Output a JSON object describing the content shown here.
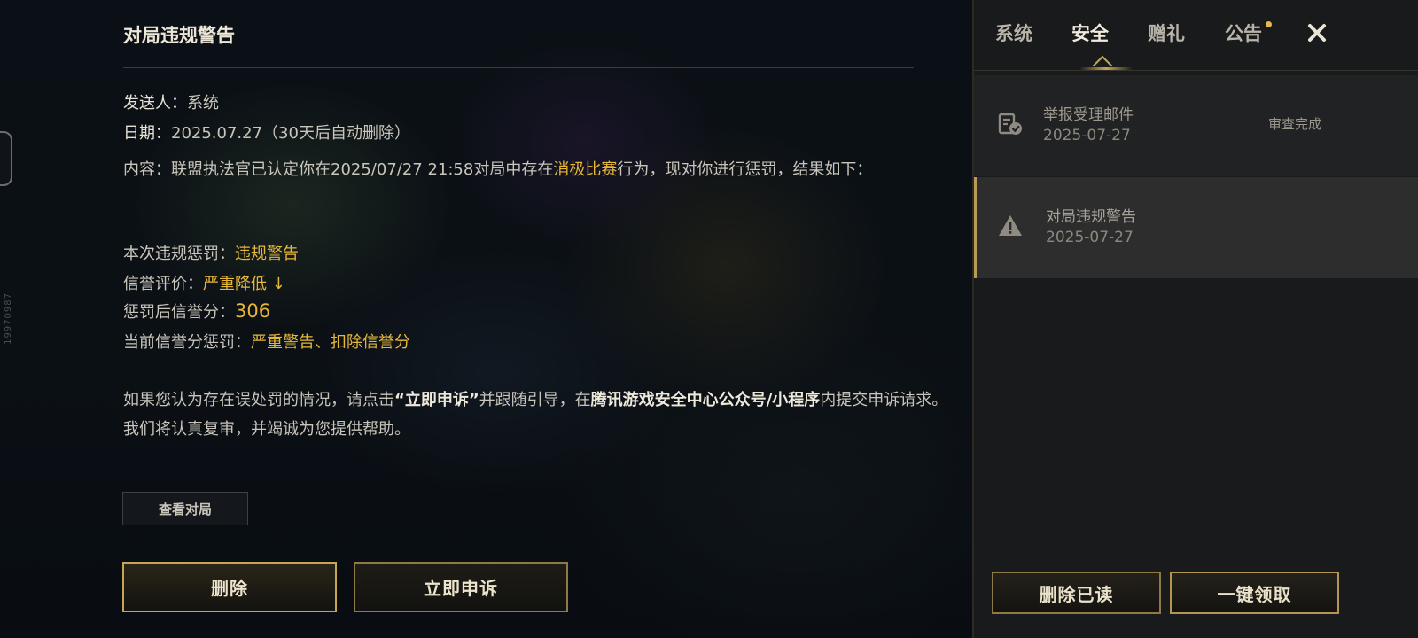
{
  "side_id": "19970987",
  "mail": {
    "title": "对局违规警告",
    "sender_label": "发送人：",
    "sender_value": "系统",
    "date_label": "日期：",
    "date_value": "2025.07.27（30天后自动删除）",
    "content_label": "内容：",
    "content_pre": "联盟执法官已认定你在2025/07/27 21:58对局中存在",
    "content_highlight": "消极比赛",
    "content_post": "行为，现对你进行惩罚，结果如下：",
    "penalties": [
      {
        "label": "本次违规惩罚：",
        "value": "违规警告"
      },
      {
        "label": "信誉评价：",
        "value": "严重降低 ↓"
      },
      {
        "label": "惩罚后信誉分：",
        "value": "306"
      },
      {
        "label": "当前信誉分惩罚：",
        "value": "严重警告、扣除信誉分"
      }
    ],
    "appeal_pre": "如果您认为存在误处罚的情况，请点击",
    "appeal_bold1": "“立即申诉”",
    "appeal_mid": "并跟随引导，在",
    "appeal_bold2": "腾讯游戏安全中心公众号/小程序",
    "appeal_post": "内提交申诉请求。我们将认真复审，并竭诚为您提供帮助。",
    "view_match_label": "查看对局",
    "delete_label": "删除",
    "appeal_button_label": "立即申诉"
  },
  "panel": {
    "tabs": [
      "系统",
      "安全",
      "赠礼",
      "公告"
    ],
    "active_tab": "安全",
    "items": [
      {
        "name": "举报受理邮件",
        "date": "2025-07-27",
        "status": "审查完成",
        "icon": "report-mail-check-icon"
      },
      {
        "name": "对局违规警告",
        "date": "2025-07-27",
        "status": "",
        "icon": "warning-triangle-icon"
      }
    ],
    "delete_read_label": "删除已读",
    "claim_all_label": "一键领取"
  },
  "colors": {
    "highlight": "#e7b73a",
    "gold_border": "#c7a553",
    "panel_bg": "#181a1c"
  }
}
